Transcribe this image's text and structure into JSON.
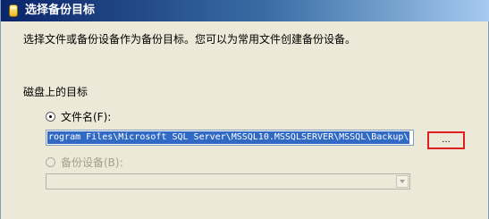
{
  "window": {
    "title": "选择备份目标",
    "description": "选择文件或备份设备作为备份目标。您可以为常用文件创建备份设备。"
  },
  "destination": {
    "section_label": "磁盘上的目标",
    "file_option": {
      "label": "文件名(F):",
      "selected": true
    },
    "file_path": "rogram Files\\Microsoft SQL Server\\MSSQL10.MSSQLSERVER\\MSSQL\\Backup\\",
    "browse_label": "...",
    "device_option": {
      "label": "备份设备(B):",
      "selected": false,
      "enabled": false
    },
    "device_selected": ""
  },
  "colors": {
    "title_bar_start": "#0a246a",
    "title_bar_end": "#a6caf0",
    "dialog_background": "#ece9d8",
    "selection": "#316ac5",
    "highlight_border": "#e01f1f",
    "disabled_text": "#a4a08f"
  },
  "icons": {
    "title": "database-icon",
    "dropdown": "chevron-down-icon"
  }
}
